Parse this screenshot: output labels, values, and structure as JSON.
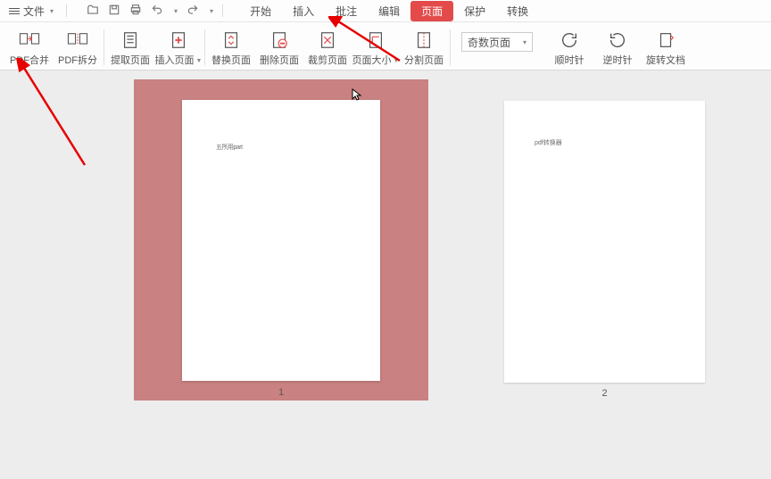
{
  "topbar": {
    "file_menu": "文件",
    "tabs": [
      "开始",
      "插入",
      "批注",
      "编辑",
      "页面",
      "保护",
      "转换"
    ],
    "active_tab_index": 4
  },
  "ribbon": {
    "buttons": [
      {
        "label": "PDF合并",
        "icon": "merge",
        "dropdown": false
      },
      {
        "label": "PDF拆分",
        "icon": "split",
        "dropdown": false
      },
      {
        "label": "提取页面",
        "icon": "extract",
        "dropdown": false
      },
      {
        "label": "插入页面",
        "icon": "insert",
        "dropdown": true
      },
      {
        "label": "替换页面",
        "icon": "replace",
        "dropdown": false
      },
      {
        "label": "删除页面",
        "icon": "delete",
        "dropdown": false
      },
      {
        "label": "裁剪页面",
        "icon": "crop",
        "dropdown": false
      },
      {
        "label": "页面大小",
        "icon": "pagesize",
        "dropdown": true
      },
      {
        "label": "分割页面",
        "icon": "divide",
        "dropdown": false
      }
    ],
    "dropdown_value": "奇数页面",
    "right_buttons": [
      {
        "label": "顺时针",
        "icon": "rotate-cw"
      },
      {
        "label": "逆时针",
        "icon": "rotate-ccw"
      },
      {
        "label": "旋转文档",
        "icon": "rotate-doc"
      }
    ]
  },
  "pages": {
    "page1_text": "五所用part",
    "page1_num": "1",
    "page2_text": "pdf转换器",
    "page2_num": "2"
  }
}
